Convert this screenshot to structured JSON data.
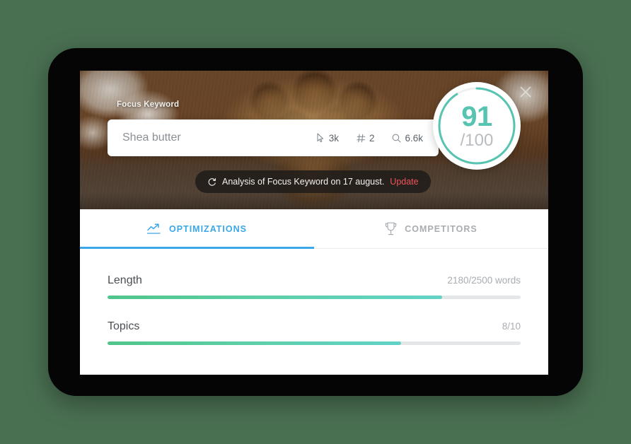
{
  "theme": {
    "background": "#4a7052",
    "accent_blue": "#3aa7e8",
    "accent_teal": "#56c4b0",
    "accent_green": "#4fc68a",
    "update_red": "#f0545c",
    "track_gray": "#e4e6e8"
  },
  "hero": {
    "focus_keyword_label": "Focus Keyword",
    "close_icon": "close-icon"
  },
  "search": {
    "value": "Shea butter",
    "placeholder": "Shea butter",
    "metrics": [
      {
        "icon": "cursor-click-icon",
        "value": "3k"
      },
      {
        "icon": "hash-icon",
        "value": "2"
      },
      {
        "icon": "search-icon",
        "value": "6.6k"
      }
    ]
  },
  "score": {
    "value": "91",
    "total": "/100",
    "percent": 91
  },
  "analysis": {
    "icon": "refresh-icon",
    "text": "Analysis of Focus Keyword on 17 august.",
    "update_label": "Update"
  },
  "tabs": [
    {
      "label": "OPTIMIZATIONS",
      "icon": "trending-up-icon",
      "active": true
    },
    {
      "label": "COMPETITORS",
      "icon": "trophy-icon",
      "active": false
    }
  ],
  "optimizations": [
    {
      "label": "Length",
      "value": "2180/2500 words",
      "percent": 81
    },
    {
      "label": "Topics",
      "value": "8/10",
      "percent": 71
    }
  ]
}
